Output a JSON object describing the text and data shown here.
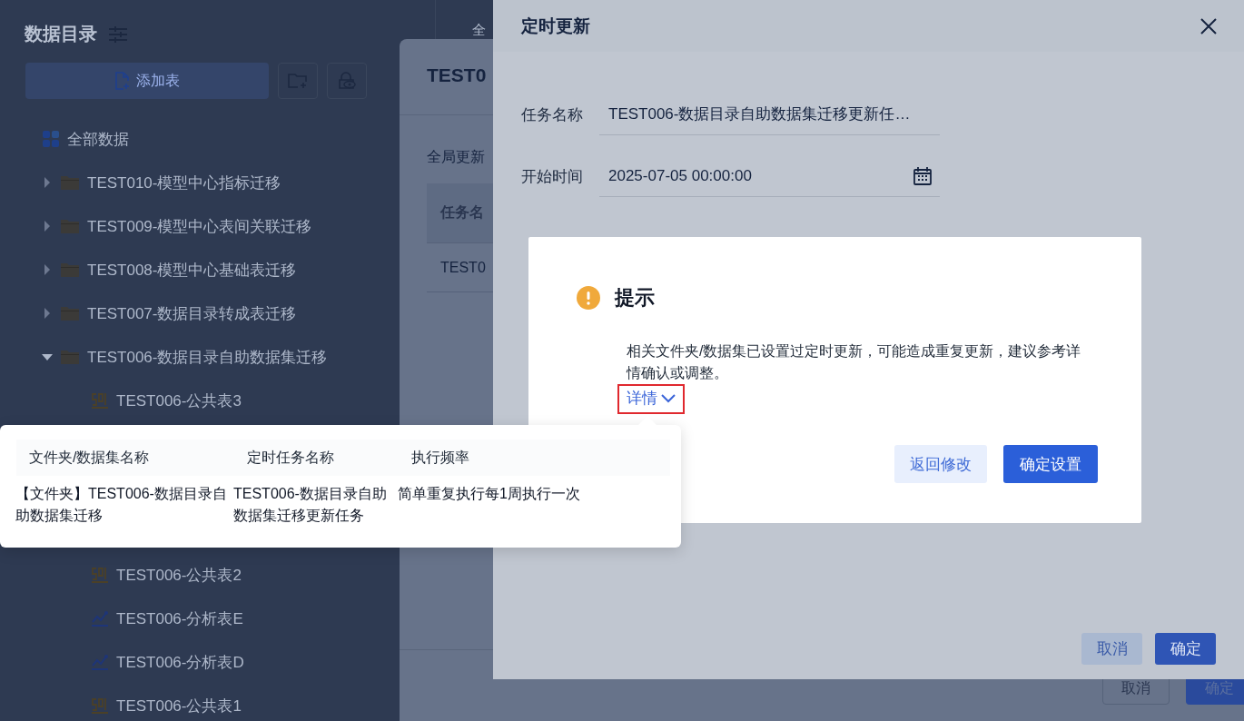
{
  "sidebar": {
    "title": "数据目录",
    "add_button": "添加表",
    "all_data": "全部数据",
    "tree": [
      {
        "label": "TEST010-模型中心指标迁移",
        "expanded": false
      },
      {
        "label": "TEST009-模型中心表间关联迁移",
        "expanded": false
      },
      {
        "label": "TEST008-模型中心基础表迁移",
        "expanded": false
      },
      {
        "label": "TEST007-数据目录转成表迁移",
        "expanded": false
      },
      {
        "label": "TEST006-数据目录自助数据集迁移",
        "expanded": true,
        "children": [
          {
            "label": "TEST006-公共表3",
            "kind": "sql"
          },
          {
            "label": "TEST006-公共表2",
            "kind": "sql"
          },
          {
            "label": "TEST006-分析表E",
            "kind": "chart"
          },
          {
            "label": "TEST006-分析表D",
            "kind": "chart"
          },
          {
            "label": "TEST006-公共表1",
            "kind": "sql"
          }
        ]
      }
    ]
  },
  "background_tab": "全",
  "task_dialog": {
    "title": "TEST0",
    "global_label": "全局更新",
    "table_header": "任务名",
    "table_cell": "TEST0",
    "buttons": [
      "取消",
      "确定"
    ]
  },
  "schedule_dialog": {
    "title": "定时更新",
    "fields": [
      {
        "label": "任务名称",
        "value": "TEST006-数据目录自助数据集迁移更新任…",
        "kind": "text"
      },
      {
        "label": "开始时间",
        "value": "2025-07-05 00:00:00",
        "kind": "date"
      }
    ],
    "buttons": [
      "取消",
      "确定"
    ]
  },
  "hint_dialog": {
    "title": "提示",
    "message": "相关文件夹/数据集已设置过定时更新，可能造成重复更新，建议参考详情确认或调整。",
    "details_link": "详情",
    "expanded": true,
    "highlighted": true,
    "buttons": [
      "返回修改",
      "确定设置"
    ]
  },
  "details_popover": {
    "columns": [
      "文件夹/数据集名称",
      "定时任务名称",
      "执行频率"
    ],
    "rows": [
      [
        "【文件夹】TEST006-数据目录自助数据集迁移",
        "TEST006-数据目录自助数据集迁移更新任务",
        "简单重复执行每1周执行一次"
      ]
    ]
  }
}
